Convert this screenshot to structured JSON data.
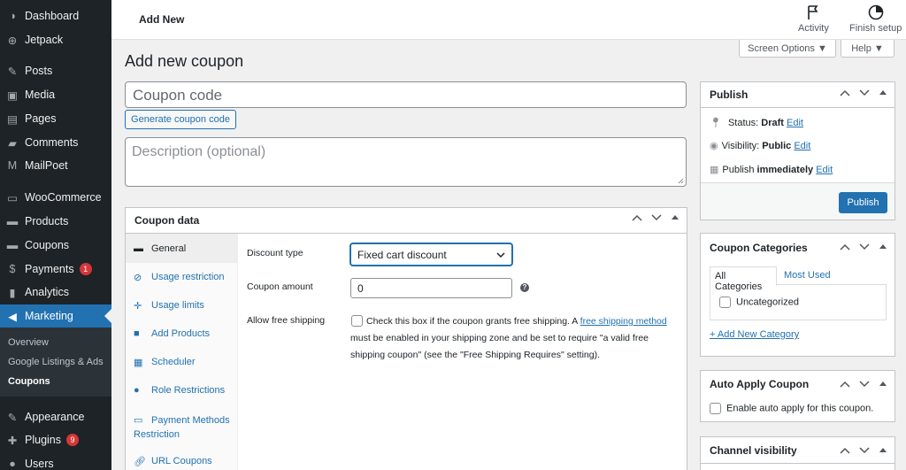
{
  "sidebar": {
    "items": [
      {
        "label": "Dashboard",
        "icon": "dashboard-icon"
      },
      {
        "label": "Jetpack",
        "icon": "jetpack-icon"
      },
      {
        "label": "Posts",
        "icon": "pin-icon"
      },
      {
        "label": "Media",
        "icon": "media-icon"
      },
      {
        "label": "Pages",
        "icon": "pages-icon"
      },
      {
        "label": "Comments",
        "icon": "comments-icon"
      },
      {
        "label": "MailPoet",
        "icon": "mailpoet-icon"
      },
      {
        "label": "WooCommerce",
        "icon": "woo-icon"
      },
      {
        "label": "Products",
        "icon": "products-icon"
      },
      {
        "label": "Coupons",
        "icon": "coupons-icon"
      },
      {
        "label": "Payments",
        "icon": "payments-icon",
        "badge": "1"
      },
      {
        "label": "Analytics",
        "icon": "analytics-icon"
      },
      {
        "label": "Marketing",
        "icon": "megaphone-icon"
      },
      {
        "label": "Appearance",
        "icon": "brush-icon"
      },
      {
        "label": "Plugins",
        "icon": "plug-icon",
        "badge": "9"
      },
      {
        "label": "Users",
        "icon": "users-icon"
      }
    ],
    "submenu": [
      "Overview",
      "Google Listings & Ads",
      "Coupons"
    ]
  },
  "topbar": {
    "title": "Add New",
    "activity": "Activity",
    "finish_setup": "Finish setup"
  },
  "screen_options": "Screen Options ▼",
  "help": "Help ▼",
  "page_title": "Add new coupon",
  "coupon_code_placeholder": "Coupon code",
  "generate_label": "Generate coupon code",
  "description_placeholder": "Description (optional)",
  "coupon_data": {
    "title": "Coupon data",
    "tabs": [
      "General",
      "Usage restriction",
      "Usage limits",
      "Add Products",
      "Scheduler",
      "Role Restrictions",
      "Payment Methods Restriction",
      "URL Coupons"
    ],
    "discount_type_label": "Discount type",
    "discount_type_value": "Fixed cart discount",
    "coupon_amount_label": "Coupon amount",
    "coupon_amount_value": "0",
    "free_shipping_label": "Allow free shipping",
    "free_shipping_text1": "Check this box if the coupon grants free shipping. A ",
    "free_shipping_link": "free shipping method",
    "free_shipping_text2": " must be enabled in your shipping zone and be set to require \"a valid free shipping coupon\" (see the \"Free Shipping Requires\" setting)."
  },
  "publish": {
    "title": "Publish",
    "status_label": "Status:",
    "status_value": "Draft",
    "visibility_label": "Visibility:",
    "visibility_value": "Public",
    "publish_label": "Publish",
    "publish_value": "immediately",
    "edit": "Edit",
    "button": "Publish"
  },
  "categories": {
    "title": "Coupon Categories",
    "tab_all": "All Categories",
    "tab_most": "Most Used",
    "item": "Uncategorized",
    "add": "+ Add New Category"
  },
  "auto_apply": {
    "title": "Auto Apply Coupon",
    "label": "Enable auto apply for this coupon."
  },
  "channel": {
    "title": "Channel visibility"
  }
}
